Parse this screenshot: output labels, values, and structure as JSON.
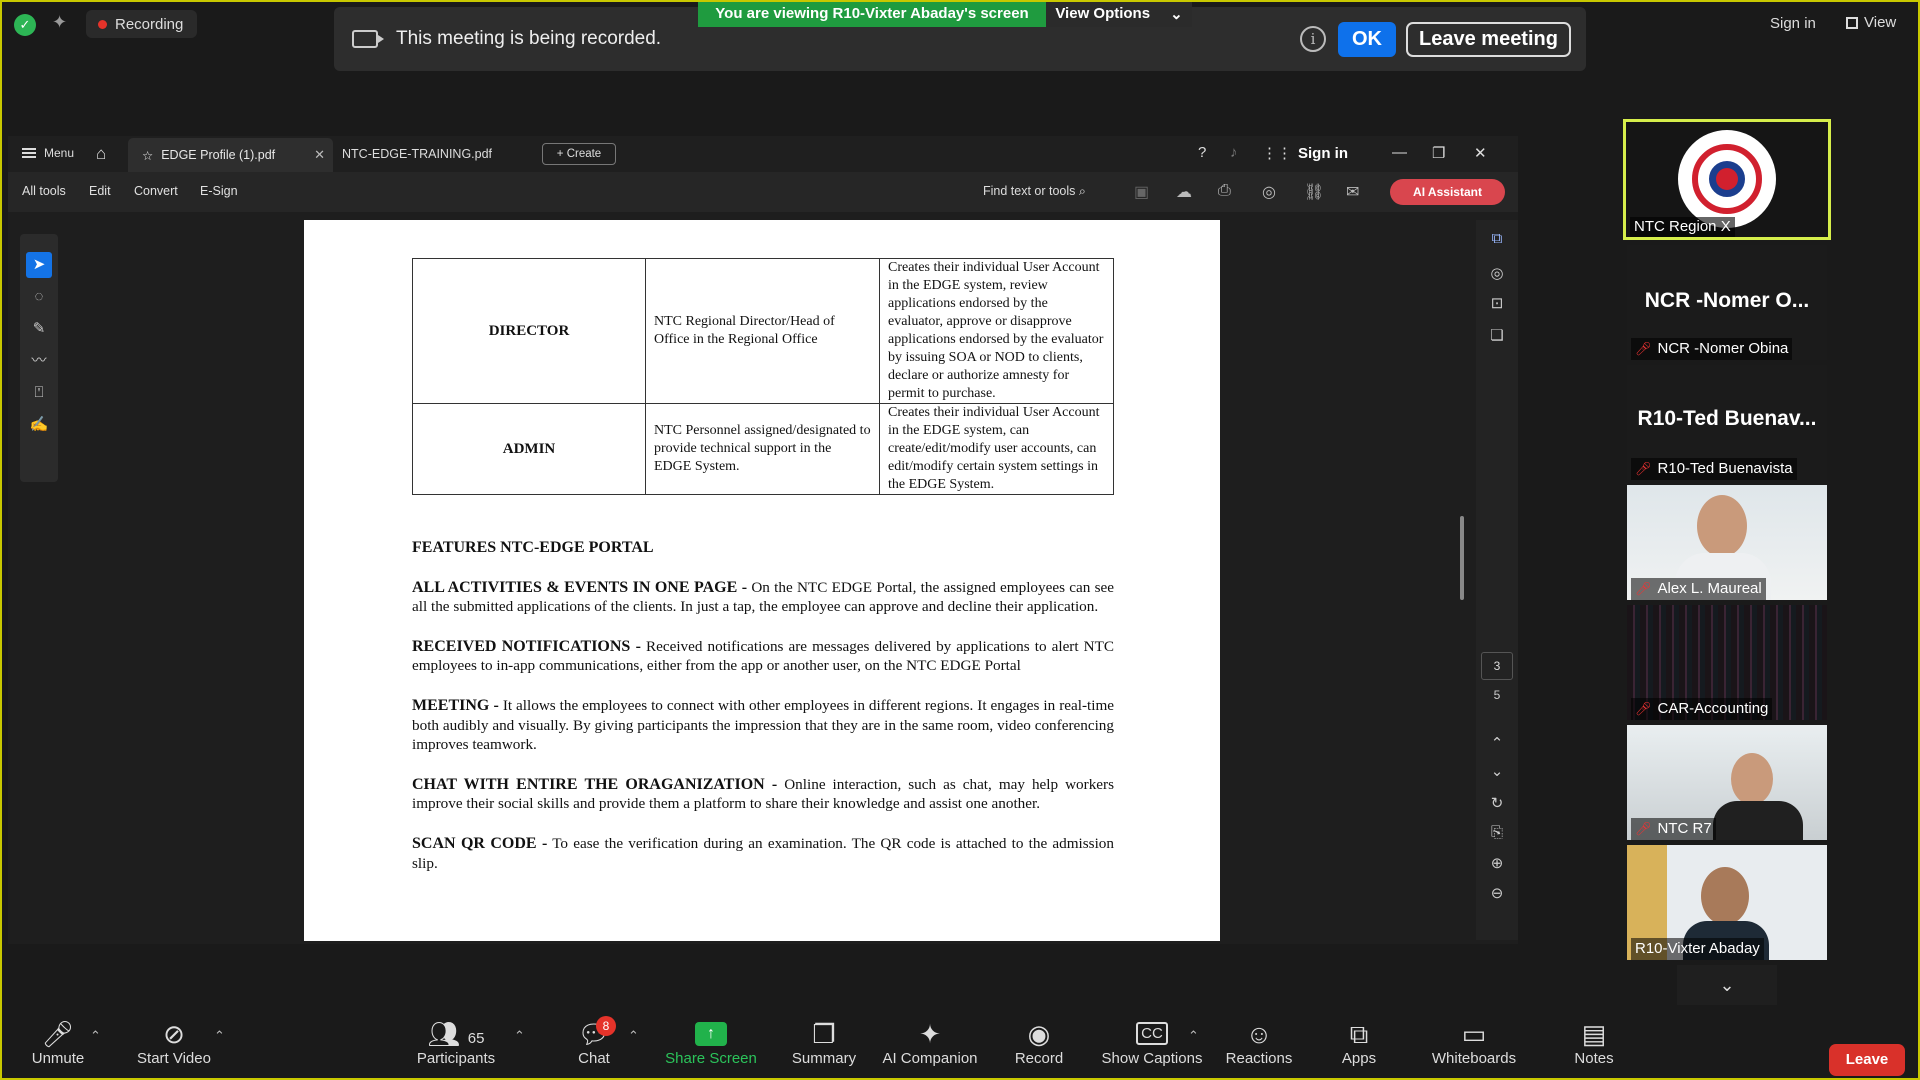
{
  "top": {
    "recording_label": "Recording",
    "viewing_banner": "You are viewing R10-Vixter Abaday's screen",
    "view_options": "View Options",
    "recorded_msg": "This meeting is being recorded.",
    "ok": "OK",
    "leave_meeting": "Leave meeting",
    "sign_in": "Sign in",
    "view": "View"
  },
  "acrobat": {
    "menu": "Menu",
    "tabs": [
      "EDGE Profile (1).pdf",
      "NTC-EDGE-TRAINING.pdf"
    ],
    "create": "Create",
    "sign_in": "Sign in",
    "toolbar": [
      "All tools",
      "Edit",
      "Convert",
      "E-Sign"
    ],
    "find": "Find text or tools",
    "ai_assistant": "AI Assistant",
    "current_page": "3",
    "total_pages": "5"
  },
  "document": {
    "table": [
      {
        "role": "DIRECTOR",
        "who": "NTC Regional Director/Head of Office in the Regional Office",
        "desc": "Creates their individual User Account in the EDGE system, review applications endorsed by the evaluator, approve or disapprove applications endorsed by the evaluator by issuing SOA or NOD to clients, declare or authorize amnesty for permit to purchase."
      },
      {
        "role": "ADMIN",
        "who": "NTC Personnel assigned/designated to provide technical support in the EDGE System.",
        "desc": "Creates their individual User Account in the EDGE system, can create/edit/modify user accounts, can edit/modify certain system settings in the EDGE System."
      }
    ],
    "features_heading": "FEATURES NTC-EDGE PORTAL",
    "features": [
      {
        "title": "ALL ACTIVITIES & EVENTS IN ONE PAGE -",
        "body": "On the NTC EDGE Portal, the assigned employees can see all the submitted applications of the clients. In just a tap, the employee can approve and decline their application."
      },
      {
        "title": "RECEIVED NOTIFICATIONS -",
        "body": "Received notifications are messages delivered by applications to alert NTC employees to in-app communications, either from the app or another user, on the NTC EDGE Portal"
      },
      {
        "title": "MEETING -",
        "body": "It allows the employees to connect with other employees in different regions. It engages in real-time both audibly and visually. By giving participants the impression that they are in the same room, video conferencing improves teamwork."
      },
      {
        "title": "CHAT WITH ENTIRE THE ORAGANIZATION -",
        "body": "Online interaction, such as chat, may help workers improve their social skills and provide them a platform to share their knowledge and assist one another."
      },
      {
        "title": "SCAN QR CODE -",
        "body": "To ease the verification during an examination. The QR code is attached to the admission slip."
      }
    ]
  },
  "participants": {
    "ntc": "NTC Region X",
    "ncr_big": "NCR -Nomer O...",
    "ncr": "NCR -Nomer Obina",
    "r10_big": "R10-Ted Buenav...",
    "r10": "R10-Ted Buenavista",
    "alex": "Alex L. Maureal",
    "car": "CAR-Accounting",
    "r7": "NTC R7",
    "vixter": "R10-Vixter Abaday"
  },
  "bottom": {
    "unmute": "Unmute",
    "start_video": "Start Video",
    "participants": "Participants",
    "participant_count": "65",
    "chat": "Chat",
    "chat_badge": "8",
    "share_screen": "Share Screen",
    "summary": "Summary",
    "ai_companion": "AI Companion",
    "record": "Record",
    "show_captions": "Show Captions",
    "reactions": "Reactions",
    "apps": "Apps",
    "whiteboards": "Whiteboards",
    "notes": "Notes",
    "leave": "Leave"
  }
}
